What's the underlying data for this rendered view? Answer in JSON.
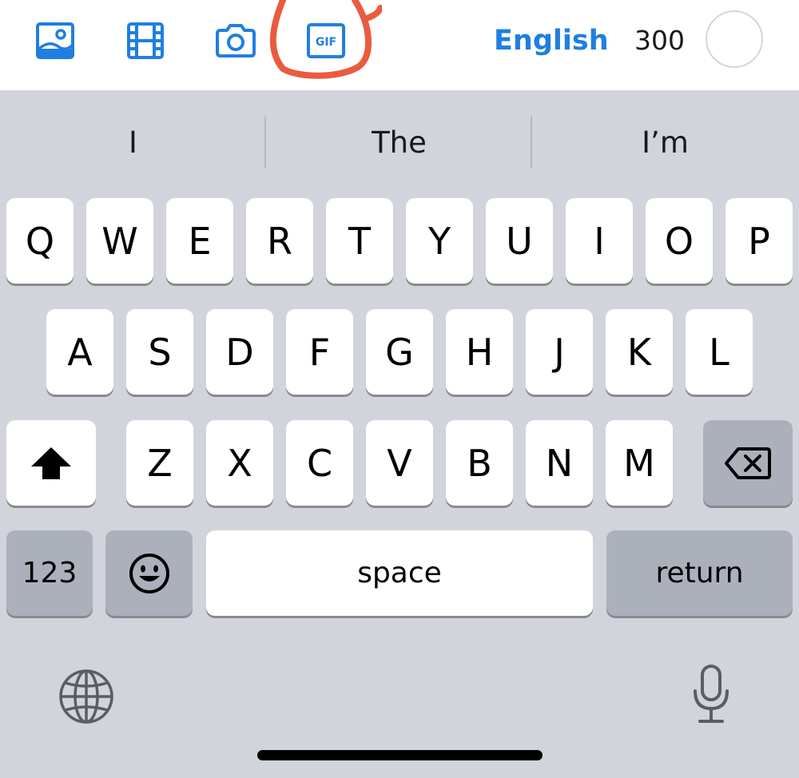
{
  "toolbar": {
    "buttons": [
      {
        "name": "photo-icon"
      },
      {
        "name": "video-icon"
      },
      {
        "name": "camera-icon"
      },
      {
        "name": "gif-icon",
        "label": "GIF"
      }
    ],
    "language": "English",
    "char_count": "300",
    "accent_color": "#1f7fe0",
    "annotation_color": "#ea5b3f"
  },
  "suggestions": [
    "I",
    "The",
    "I’m"
  ],
  "keyboard": {
    "row1": [
      "Q",
      "W",
      "E",
      "R",
      "T",
      "Y",
      "U",
      "I",
      "O",
      "P"
    ],
    "row2": [
      "A",
      "S",
      "D",
      "F",
      "G",
      "H",
      "J",
      "K",
      "L"
    ],
    "row3": [
      "Z",
      "X",
      "C",
      "V",
      "B",
      "N",
      "M"
    ],
    "shift_icon": "shift-arrow-icon",
    "delete_icon": "delete-backspace-icon",
    "numbers_label": "123",
    "emoji_icon": "emoji-smiley-icon",
    "space_label": "space",
    "return_label": "return",
    "globe_icon": "globe-icon",
    "mic_icon": "microphone-icon",
    "key_color": "#ffffff",
    "function_key_color": "#abb0bb",
    "background_color": "#d1d4db"
  }
}
